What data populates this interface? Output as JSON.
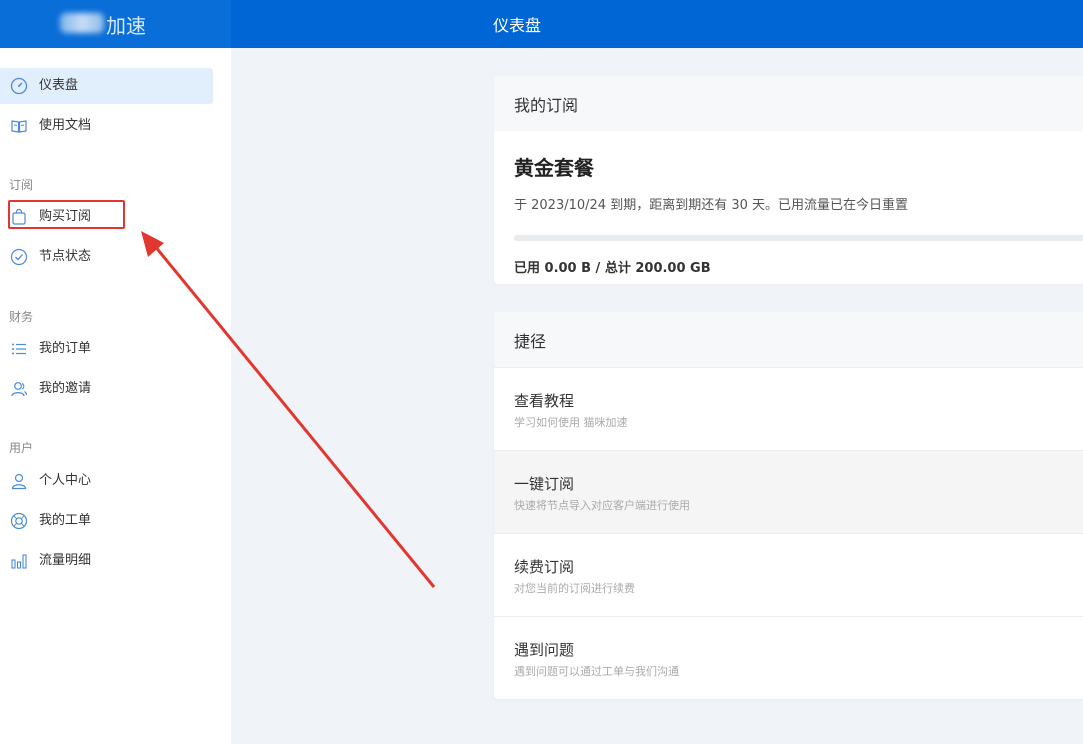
{
  "brand": {
    "name": "加速"
  },
  "header": {
    "title": "仪表盘"
  },
  "sidebar": {
    "items_top": [
      {
        "label": "仪表盘",
        "icon": "dashboard-icon"
      },
      {
        "label": "使用文档",
        "icon": "book-icon"
      }
    ],
    "groups": [
      {
        "title": "订阅",
        "items": [
          {
            "label": "购买订阅",
            "icon": "shopping-bag-icon"
          },
          {
            "label": "节点状态",
            "icon": "check-circle-icon"
          }
        ]
      },
      {
        "title": "财务",
        "items": [
          {
            "label": "我的订单",
            "icon": "list-icon"
          },
          {
            "label": "我的邀请",
            "icon": "users-icon"
          }
        ]
      },
      {
        "title": "用户",
        "items": [
          {
            "label": "个人中心",
            "icon": "user-icon"
          },
          {
            "label": "我的工单",
            "icon": "support-icon"
          },
          {
            "label": "流量明细",
            "icon": "bar-chart-icon"
          }
        ]
      }
    ]
  },
  "subscription": {
    "header": "我的订阅",
    "plan": "黄金套餐",
    "info": "于 2023/10/24 到期，距离到期还有 30 天。已用流量已在今日重置",
    "usage": "已用 0.00 B / 总计 200.00 GB",
    "progress": 0
  },
  "shortcuts": {
    "header": "捷径",
    "items": [
      {
        "title": "查看教程",
        "desc": "学习如何使用 猫咪加速"
      },
      {
        "title": "一键订阅",
        "desc": "快速将节点导入对应客户端进行使用"
      },
      {
        "title": "续费订阅",
        "desc": "对您当前的订阅进行续费"
      },
      {
        "title": "遇到问题",
        "desc": "遇到问题可以通过工单与我们沟通"
      }
    ]
  },
  "colors": {
    "header": "#0066d6",
    "accent": "#0a6ed8",
    "annotation": "#e2372f"
  }
}
